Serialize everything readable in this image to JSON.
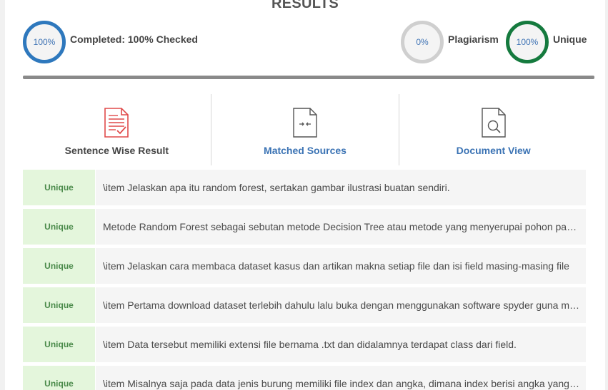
{
  "title": "RESULTS",
  "stats": {
    "completed_ring": "100%",
    "completed_label": "Completed: 100% Checked",
    "plagiarism_ring": "0%",
    "plagiarism_label": "Plagiarism",
    "unique_ring": "100%",
    "unique_label": "Unique"
  },
  "progress": {
    "value": 1.0
  },
  "tabs": [
    {
      "label": "Sentence Wise Result",
      "icon": "document-check-icon",
      "active": true
    },
    {
      "label": "Matched Sources",
      "icon": "document-arrows-icon",
      "active": false
    },
    {
      "label": "Document View",
      "icon": "document-search-icon",
      "active": false
    }
  ],
  "colors": {
    "ring_blue": "#2e78bd",
    "ring_grey": "#cfcfcf",
    "ring_green": "#157a3e",
    "badge_bg": "#e4f6dc",
    "link": "#3b73b4",
    "icon_red": "#e04a4a"
  },
  "results": [
    {
      "status": "Unique",
      "sentence": "\\item Jelaskan apa itu random forest, sertakan gambar ilustrasi buatan sendiri."
    },
    {
      "status": "Unique",
      "sentence": "Metode Random Forest sebagai sebutan metode Decision Tree atau metode yang menyerupai pohon pada pengambilan keputusan"
    },
    {
      "status": "Unique",
      "sentence": "\\item Jelaskan cara membaca dataset kasus dan artikan makna setiap file dan isi field masing-masing file"
    },
    {
      "status": "Unique",
      "sentence": "\\item Pertama download dataset terlebih dahulu lalu buka dengan menggunakan software spyder guna membaca data"
    },
    {
      "status": "Unique",
      "sentence": "\\item Data tersebut memiliki extensi file bernama .txt dan didalamnya terdapat class dari field."
    },
    {
      "status": "Unique",
      "sentence": "\\item Misalnya saja pada data jenis burung memiliki file index dan angka, dimana index berisi angka yang menunjukkan"
    }
  ]
}
